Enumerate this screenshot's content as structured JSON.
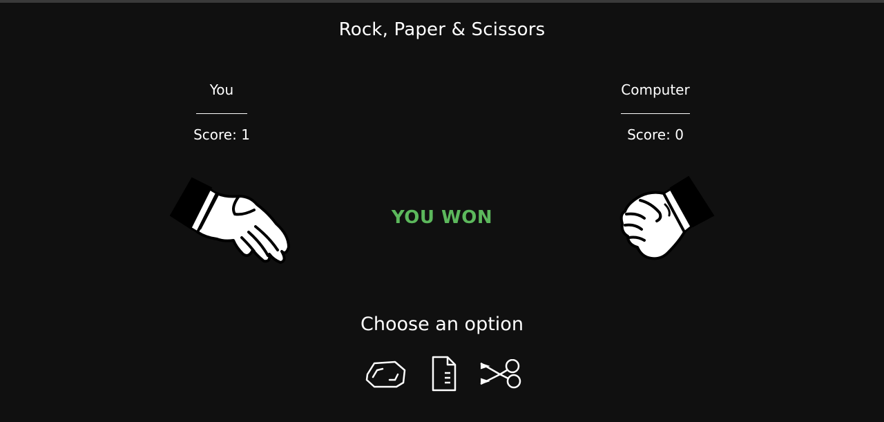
{
  "game": {
    "title": "Rock, Paper & Scissors",
    "result": "YOU WON",
    "result_color": "#5cb85c",
    "prompt": "Choose an option"
  },
  "players": {
    "you": {
      "name": "You",
      "score_text": "Score: 1",
      "choice": "paper",
      "hand_icon": "open-hand-icon"
    },
    "computer": {
      "name": "Computer",
      "score_text": "Score: 0",
      "choice": "rock",
      "hand_icon": "fist-icon"
    }
  },
  "options": [
    {
      "id": "rock",
      "icon": "rock-icon"
    },
    {
      "id": "paper",
      "icon": "paper-icon"
    },
    {
      "id": "scissors",
      "icon": "scissors-icon"
    }
  ]
}
